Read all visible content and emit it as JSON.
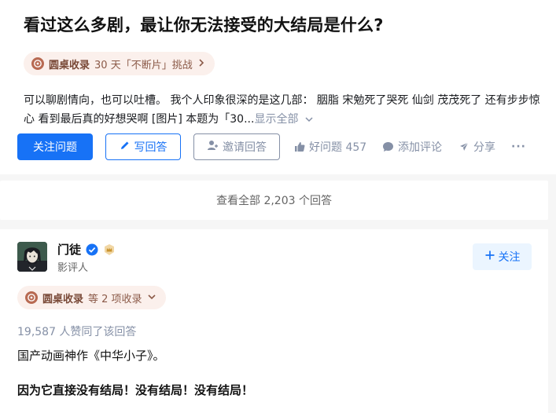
{
  "question": {
    "title": "看过这么多剧，最让你无法接受的大结局是什么?",
    "collection": {
      "name": "圆桌收录",
      "detail": "30 天「不断片」挑战",
      "chevron": "›"
    },
    "description": "可以聊剧情向，也可以吐槽。 我个人印象很深的是这几部： 胭脂 宋勉死了哭死 仙剑 茂茂死了 还有步步惊心 看到最后真的好想哭啊 [图片] 本题为「30...",
    "show_all": "显示全部",
    "actions": {
      "follow_label": "关注问题",
      "write_label": "写回答",
      "invite_label": "邀请回答",
      "good_question_label": "好问题 457",
      "comment_label": "添加评论",
      "share_label": "分享",
      "more_label": "···"
    }
  },
  "view_all": "查看全部 2,203 个回答",
  "answer": {
    "author": {
      "name": "门徒",
      "role": "影评人",
      "follow_label": "关注"
    },
    "collection": {
      "name": "圆桌收录",
      "detail": "等 2 项收录"
    },
    "vote_text": "19,587 人赞同了该回答",
    "paragraphs": [
      "国产动画神作《中华小子》。",
      "因为它直接没有结局！没有结局！没有结局！"
    ]
  },
  "colors": {
    "accent": "#1772f6",
    "muted": "#8590a6",
    "pill_bg": "#fbf0ec",
    "pill_text": "#8b5a48"
  },
  "icons": [
    "roundtable-badge-icon",
    "chevron-right-icon",
    "pen-icon",
    "invite-user-icon",
    "thumbs-up-icon",
    "comment-bubble-icon",
    "share-plane-icon",
    "more-dots-icon",
    "verified-check-icon",
    "crown-badge-icon",
    "plus-icon",
    "chevron-down-icon"
  ]
}
